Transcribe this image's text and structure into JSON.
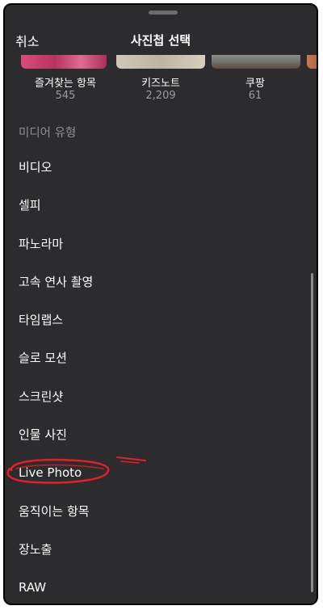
{
  "header": {
    "cancel_label": "취소",
    "title": "사진첩 선택"
  },
  "albums": [
    {
      "name": "즐겨찾는 항목",
      "count": "545"
    },
    {
      "name": "키즈노트",
      "count": "2,209"
    },
    {
      "name": "쿠팡",
      "count": "61"
    }
  ],
  "section_header": "미디어 유형",
  "media_types": [
    {
      "label": "비디오"
    },
    {
      "label": "셀피"
    },
    {
      "label": "파노라마"
    },
    {
      "label": "고속 연사 촬영"
    },
    {
      "label": "타임랩스"
    },
    {
      "label": "슬로 모션"
    },
    {
      "label": "스크린샷"
    },
    {
      "label": "인물 사진"
    },
    {
      "label": "Live Photo"
    },
    {
      "label": "움직이는 항목"
    },
    {
      "label": "장노출"
    },
    {
      "label": "RAW"
    }
  ],
  "colors": {
    "background": "#2c2c2e",
    "text": "#ffffff",
    "secondary_text": "#8e8e93",
    "annotation": "#e0202a"
  }
}
